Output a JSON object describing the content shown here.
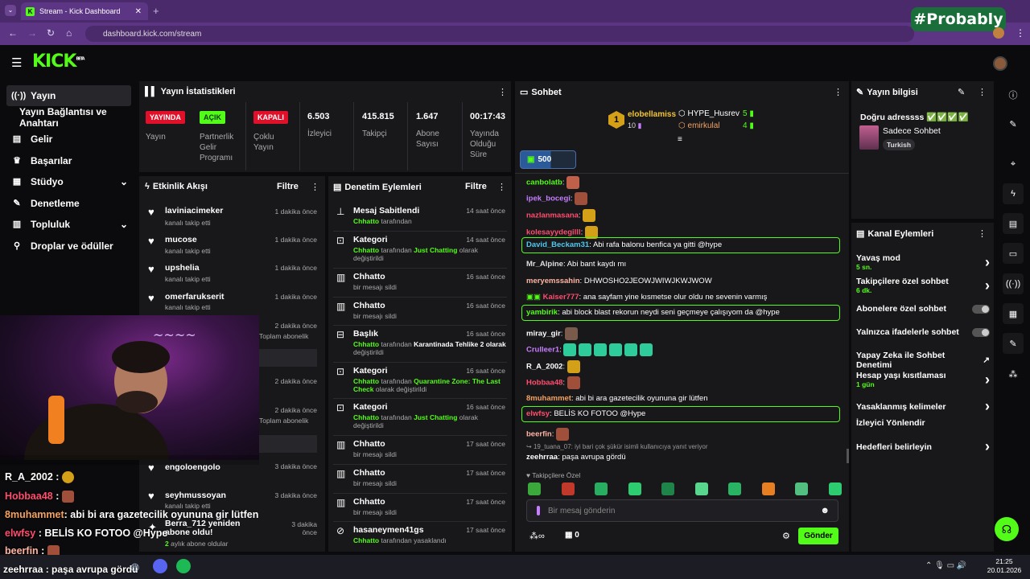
{
  "browser": {
    "tab_title": "Stream - Kick Dashboard",
    "url": "dashboard.kick.com/stream",
    "watermark": "#Probably"
  },
  "app": {
    "logo": "KICK",
    "logo_sup": "BETA"
  },
  "sidebar": {
    "items": [
      {
        "label": "Yayın",
        "icon": "broadcast-icon"
      },
      {
        "label": "Yayın Bağlantısı ve Anahtarı",
        "icon": ""
      },
      {
        "label": "Gelir",
        "icon": "money-icon"
      },
      {
        "label": "Başarılar",
        "icon": "trophy-icon"
      },
      {
        "label": "Stüdyo",
        "icon": "studio-icon"
      },
      {
        "label": "Denetleme",
        "icon": "wrench-icon"
      },
      {
        "label": "Topluluk",
        "icon": "community-icon"
      },
      {
        "label": "Droplar ve ödüller",
        "icon": "gift-icon"
      }
    ]
  },
  "stats": {
    "title": "Yayın İstatistikleri",
    "status_badge": "YAYINDA",
    "status_label": "Yayın",
    "partner_badge": "AÇIK",
    "partner_label": "Partnerlik Gelir Programı",
    "multi_badge": "KAPALI",
    "multi_label": "Çoklu Yayın",
    "viewers_val": "6.503",
    "viewers_label": "İzleyici",
    "followers_val": "415.815",
    "followers_label": "Takipçi",
    "subs_val": "1.647",
    "subs_label": "Abone Sayısı",
    "time_val": "00:17:43",
    "time_label": "Yayında Olduğu Süre"
  },
  "activity": {
    "title": "Etkinlik Akışı",
    "filter": "Filtre",
    "items": [
      {
        "name": "laviniacimeker",
        "sub": "kanalı takip etti",
        "time": "1 dakika önce"
      },
      {
        "name": "mucose",
        "sub": "kanalı takip etti",
        "time": "1 dakika önce"
      },
      {
        "name": "upshelia",
        "sub": "kanalı takip etti",
        "time": "1 dakika önce"
      },
      {
        "name": "omerfarukserit",
        "sub": "kanalı takip etti",
        "time": "1 dakika önce"
      }
    ],
    "partial": [
      {
        "time": "2 dakika önce",
        "sub": "Toplam abonelik"
      },
      {
        "time": "2 dakika önce"
      },
      {
        "time": "2 dakika önce",
        "sub": "Toplam abonelik"
      }
    ],
    "bottom": [
      {
        "name": "engoloengolo",
        "sub": "",
        "time": "3 dakika önce"
      },
      {
        "name": "seyhmussoyan",
        "sub": "kanalı takip etti",
        "time": "3 dakika önce"
      },
      {
        "name": "Berra_712 yeniden abone oldu!",
        "sub_green": "2",
        "sub": "aylık abone oldular",
        "time": "3 dakika önce"
      }
    ]
  },
  "moderation": {
    "title": "Denetim Eylemleri",
    "filter": "Filtre",
    "items": [
      {
        "title": "Mesaj Sabitlendi",
        "time": "14 saat önce",
        "l1a": "Chhatto",
        "l1b": " tarafından",
        "l1c": "",
        "l1d": "",
        "l2": "",
        "icon": "pin-icon"
      },
      {
        "title": "Kategori",
        "time": "14 saat önce",
        "l1a": "Chhatto",
        "l1b": " tarafından ",
        "l1c": "Just Chatting",
        "l1d": " olarak",
        "l2": "değiştirildi",
        "icon": "category-icon"
      },
      {
        "title": "Chhatto",
        "time": "16 saat önce",
        "l1a": "",
        "l1b": "bir mesajı sildi",
        "l1c": "",
        "l1d": "",
        "l2": "",
        "icon": "trash-icon"
      },
      {
        "title": "Chhatto",
        "time": "16 saat önce",
        "l1a": "",
        "l1b": "bir mesajı sildi",
        "l1c": "",
        "l1d": "",
        "l2": "",
        "icon": "trash-icon"
      },
      {
        "title": "Başlık",
        "time": "16 saat önce",
        "l1a": "Chhatto",
        "l1b": " tarafından ",
        "l1c": "",
        "l1d": "Karantinada Tehlike 2 olarak",
        "l2": "değiştirildi",
        "icon": "title-icon"
      },
      {
        "title": "Kategori",
        "time": "16 saat önce",
        "l1a": "Chhatto",
        "l1b": " tarafından ",
        "l1c": "Quarantine Zone: The Last",
        "l1d": "",
        "l2c": "Check",
        "l2": " olarak değiştirildi",
        "icon": "category-icon"
      },
      {
        "title": "Kategori",
        "time": "16 saat önce",
        "l1a": "Chhatto",
        "l1b": " tarafından ",
        "l1c": "Just Chatting",
        "l1d": " olarak",
        "l2": "değiştirildi",
        "icon": "category-icon"
      },
      {
        "title": "Chhatto",
        "time": "17 saat önce",
        "l1a": "",
        "l1b": "bir mesajı sildi",
        "l1c": "",
        "l1d": "",
        "l2": "",
        "icon": "trash-icon"
      },
      {
        "title": "Chhatto",
        "time": "17 saat önce",
        "l1a": "",
        "l1b": "bir mesajı sildi",
        "l1c": "",
        "l1d": "",
        "l2": "",
        "icon": "trash-icon"
      },
      {
        "title": "Chhatto",
        "time": "17 saat önce",
        "l1a": "",
        "l1b": "bir mesajı sildi",
        "l1c": "",
        "l1d": "",
        "l2": "",
        "icon": "trash-icon"
      },
      {
        "title": "hasaneymen41gs",
        "time": "17 saat önce",
        "l1a": "Chhatto",
        "l1b": " tarafından yasaklandı",
        "l1c": "",
        "l1d": "",
        "l2": "",
        "icon": "ban-icon"
      }
    ]
  },
  "chat": {
    "title": "Sohbet",
    "top1": {
      "rank": "1",
      "name": "elobellamiss",
      "val": "10"
    },
    "top2": {
      "name": "HYPE_Husrev",
      "val": "5"
    },
    "top3": {
      "name": "emirkulal",
      "val": "4"
    },
    "goal": "500",
    "messages": [
      {
        "user": "canbolatb",
        "color": "#53fc18",
        "text": "",
        "hl": false
      },
      {
        "user": "ipek_bocegi",
        "color": "#c77dff",
        "text": "",
        "hl": false
      },
      {
        "user": "nazlanmasana",
        "color": "#ff4d6d",
        "text": "",
        "hl": false
      },
      {
        "user": "kolesayydegilll",
        "color": "#ff4d6d",
        "text": "",
        "hl": false
      },
      {
        "user": "David_Beckam31",
        "color": "#4cc9f0",
        "text": "Abi rafa balonu benfica ya gitti @hype",
        "hl": true
      },
      {
        "user": "Mr_Alpine",
        "color": "#dddddd",
        "text": "Abi bant kaydı mı",
        "hl": false
      },
      {
        "user": "meryemssahin",
        "color": "#ffb4a2",
        "text": "DHWOSHO2JEOWJWIWJKWJWOW",
        "hl": false
      },
      {
        "user": "Kaiser777",
        "color": "#ff4d6d",
        "text": "ana sayfam yine kısmetse olur oldu ne sevenin varmış",
        "hl": false
      },
      {
        "user": "yambirik",
        "color": "#53fc18",
        "text": "abi block blast rekorun neydi seni geçmeye çalışıyom da @hype",
        "hl": true
      },
      {
        "user": "miray_gir",
        "color": "#ffffff",
        "text": "",
        "hl": false
      },
      {
        "user": "Crulleer1",
        "color": "#c77dff",
        "text": "",
        "hl": false
      },
      {
        "user": "R_A_2002",
        "color": "#ffffff",
        "text": "",
        "hl": false
      },
      {
        "user": "Hobbaa48",
        "color": "#ff4d6d",
        "text": "",
        "hl": false
      },
      {
        "user": "8muhammet",
        "color": "#f4a261",
        "text": "abi bi ara gazetecilik oyununa gir lütfen",
        "hl": false
      },
      {
        "user": "elwfsy",
        "color": "#ff4d6d",
        "text": "BELİS KO FOTOO @Hype",
        "hl": true
      },
      {
        "user": "beerfin",
        "color": "#ffb4a2",
        "text": "",
        "hl": false
      }
    ],
    "reply_hint": "19_tuana_07: iyi bari çok şükür isimli kullanıcıya yanıt veriyor",
    "last_user": "zeehrraa",
    "last_text": "paşa avrupa gördü",
    "followers_only": "Takipçilere Özel",
    "input_placeholder": "Bir mesaj gönderin",
    "gift_count": "0",
    "send": "Gönder"
  },
  "stream_info": {
    "title": "Yayın bilgisi",
    "stream_title": "Doğru adressss ✅✅✅✅",
    "category": "Sadece Sohbet",
    "tag": "Turkish"
  },
  "channel_actions": {
    "title": "Kanal Eylemleri",
    "items": [
      {
        "label": "Yavaş mod",
        "sub": "5 sn.",
        "ctrl": "chevron"
      },
      {
        "label": "Takipçilere özel sohbet",
        "sub": "6 dk.",
        "ctrl": "chevron"
      },
      {
        "label": "Abonelere özel sohbet",
        "sub": "",
        "ctrl": "toggle"
      },
      {
        "label": "Yalnızca ifadelerle sohbet",
        "sub": "",
        "ctrl": "toggle"
      },
      {
        "label": "Yapay Zeka ile Sohbet Denetimi",
        "sub": "",
        "ctrl": "external"
      },
      {
        "label": "Hesap yaşı kısıtlaması",
        "sub": "1 gün",
        "ctrl": "chevron"
      },
      {
        "label": "Yasaklanmış kelimeler",
        "sub": "",
        "ctrl": "chevron"
      },
      {
        "label": "İzleyici Yönlendir",
        "sub": "",
        "ctrl": ""
      },
      {
        "label": "Hedefleri belirleyin",
        "sub": "",
        "ctrl": "chevron"
      }
    ]
  },
  "overlay": {
    "lines": [
      {
        "user": "R_A_2002",
        "color": "#ffffff",
        "text": ":"
      },
      {
        "user": "Hobbaa48",
        "color": "#ff4d6d",
        "text": ":"
      },
      {
        "user": "8muhammet",
        "color": "#f4a261",
        "text": ": abi bi ara gazetecilik oyununa gir lütfen"
      },
      {
        "user": "elwfsy",
        "color": "#ff4d6d",
        "text": ": BELİS KO FOTOO @Hype"
      },
      {
        "user": "beerfin",
        "color": "#ffb4a2",
        "text": ":"
      },
      {
        "user": "zeehrraa",
        "color": "#ffffff",
        "text": ": paşa avrupa gördü"
      }
    ]
  },
  "taskbar": {
    "time": "21:25",
    "date": "20.01.2026"
  }
}
